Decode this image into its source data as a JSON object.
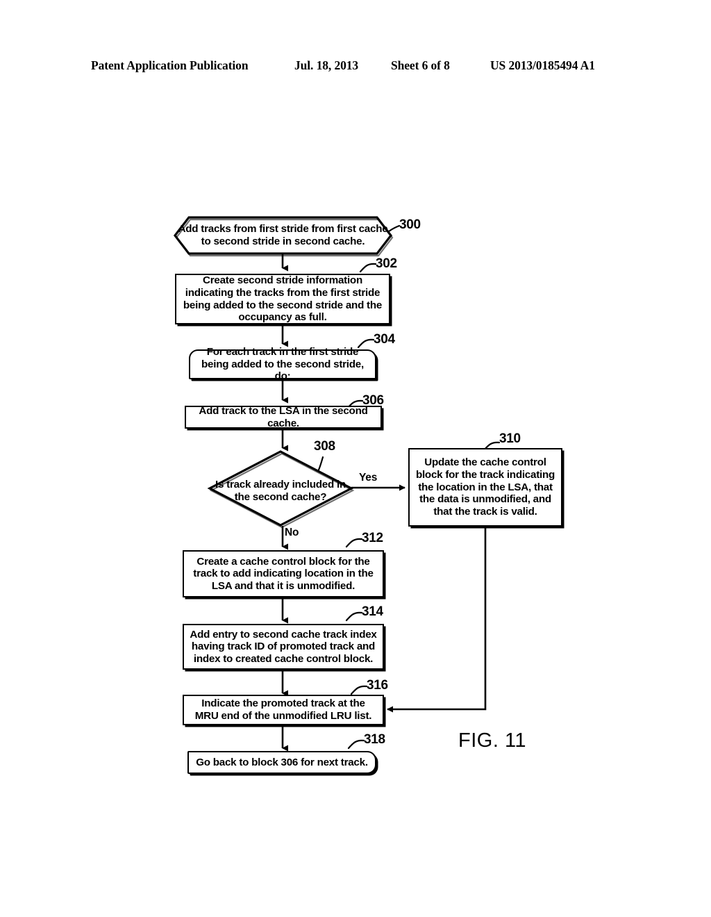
{
  "header": {
    "publication": "Patent Application Publication",
    "date": "Jul. 18, 2013",
    "sheet": "Sheet 6 of 8",
    "patent_number": "US 2013/0185494 A1"
  },
  "figure": {
    "caption": "FIG. 11"
  },
  "branches": {
    "yes": "Yes",
    "no": "No"
  },
  "nodes": [
    {
      "ref": "300",
      "shape": "hexagon-terminator",
      "text": "Add tracks from first stride from first cache to second stride in second cache."
    },
    {
      "ref": "302",
      "shape": "process",
      "text": "Create second stride information indicating the tracks from the first stride being added to the second stride and the occupancy as full."
    },
    {
      "ref": "304",
      "shape": "loop-start",
      "text": "For each track in the first stride being added to the second stride, do:"
    },
    {
      "ref": "306",
      "shape": "process",
      "text": "Add track to the LSA in the second cache."
    },
    {
      "ref": "308",
      "shape": "decision",
      "text": "Is track already included in the second cache?"
    },
    {
      "ref": "310",
      "shape": "process",
      "text": "Update the cache control block for the track indicating the location in the LSA, that the data is unmodified, and that the track is valid."
    },
    {
      "ref": "312",
      "shape": "process",
      "text": "Create a cache control block for the track to add indicating location in the LSA and that it is unmodified."
    },
    {
      "ref": "314",
      "shape": "process",
      "text": "Add entry to second cache track index having track ID of promoted track and index to created cache control block."
    },
    {
      "ref": "316",
      "shape": "process",
      "text": "Indicate the promoted track at the MRU end of the unmodified LRU list."
    },
    {
      "ref": "318",
      "shape": "loop-end",
      "text": "Go back to block 306 for next track."
    }
  ],
  "colors": {
    "ink": "#000000",
    "paper": "#ffffff"
  }
}
